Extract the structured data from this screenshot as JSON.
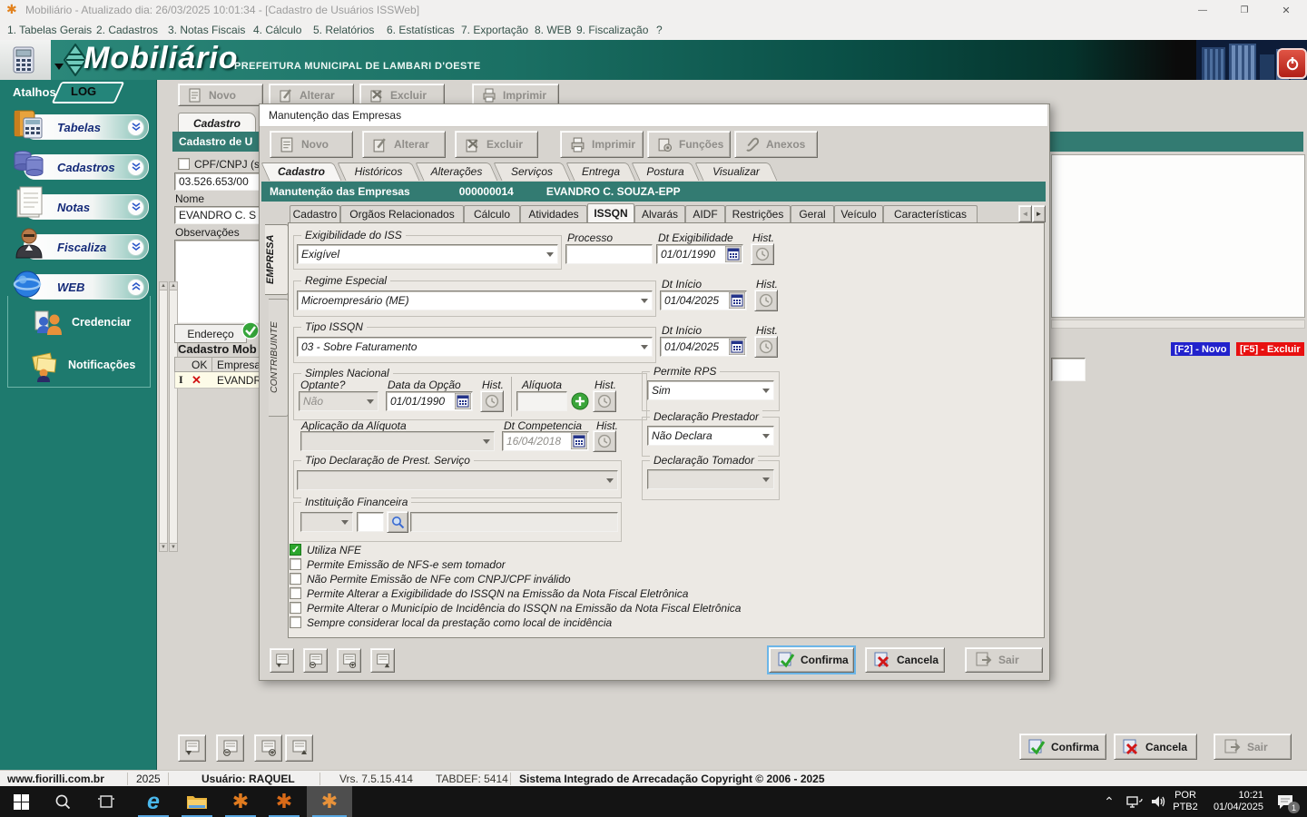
{
  "icons": {
    "app_flower": "✱",
    "minimize": "—",
    "maximize": "❐",
    "close": "✕",
    "check": "✓",
    "red_x": "✕",
    "text_cursor": "I",
    "chevron_up": "⌃",
    "arrow_left": "◄",
    "arrow_right": "►"
  },
  "window": {
    "title": "Mobiliário - Atualizado dia: 26/03/2025 10:01:34 - [Cadastro de Usuários ISSWeb]"
  },
  "menu": {
    "items": [
      "1. Tabelas Gerais",
      "2. Cadastros",
      "3. Notas Fiscais",
      "4. Cálculo",
      "5. Relatórios",
      "6. Estatísticas",
      "7. Exportação",
      "8. WEB",
      "9. Fiscalização",
      "?"
    ]
  },
  "header": {
    "logo": "Mobiliário",
    "subtitle": "PREFEITURA MUNICIPAL DE LAMBARI D'OESTE"
  },
  "sidebar": {
    "atalhos": "Atalhos",
    "log": "LOG",
    "items": [
      {
        "label": "Tabelas"
      },
      {
        "label": "Cadastros"
      },
      {
        "label": "Notas"
      },
      {
        "label": "Fiscaliza"
      },
      {
        "label": "WEB"
      }
    ],
    "web_children": [
      {
        "label": "Credenciar"
      },
      {
        "label": "Notificações"
      }
    ]
  },
  "main": {
    "toolbar": {
      "novo": "Novo",
      "alterar": "Alterar",
      "excluir": "Excluir",
      "imprimir": "Imprimir"
    },
    "tab_cadastro": "Cadastro",
    "header_title": "Cadastro de U",
    "form": {
      "cpf_label": "CPF/CNPJ (s",
      "cpf_value": "03.526.653/00",
      "nome_label": "Nome",
      "nome_value": "EVANDRO C. S",
      "obs_label": "Observações"
    },
    "endereco_tab": "Endereço",
    "cadastro_mob_title": "Cadastro Mob",
    "grid": {
      "col_ok": "OK",
      "col_empresa": "Empresa",
      "row_empresa": "EVANDR"
    },
    "badges": {
      "novo": "[F2] - Novo",
      "excluir": "[F5] - Excluir"
    },
    "footer": {
      "confirma": "Confirma",
      "cancela": "Cancela",
      "sair": "Sair"
    }
  },
  "dialog": {
    "title": "Manutenção das Empresas",
    "toolbar": {
      "novo": "Novo",
      "alterar": "Alterar",
      "excluir": "Excluir",
      "imprimir": "Imprimir",
      "funcoes": "Funções",
      "anexos": "Anexos"
    },
    "tabs": [
      {
        "label": "Cadastro"
      },
      {
        "label": "Históricos"
      },
      {
        "label": "Alterações"
      },
      {
        "label": "Serviços"
      },
      {
        "label": "Entrega"
      },
      {
        "label": "Postura"
      },
      {
        "label": "Visualizar"
      }
    ],
    "record": {
      "title": "Manutenção das Empresas",
      "code": "000000014",
      "name": "EVANDRO C. SOUZA-EPP"
    },
    "inner_tabs": [
      {
        "label": "Cadastro"
      },
      {
        "label": "Orgãos Relacionados"
      },
      {
        "label": "Cálculo"
      },
      {
        "label": "Atividades"
      },
      {
        "label": "ISSQN"
      },
      {
        "label": "Alvarás"
      },
      {
        "label": "AIDF"
      },
      {
        "label": "Restrições"
      },
      {
        "label": "Geral"
      },
      {
        "label": "Veículo"
      },
      {
        "label": "Características"
      }
    ],
    "side_tabs": {
      "empresa": "EMPRESA",
      "contribuinte": "CONTRIBUINTE"
    },
    "form": {
      "hist_label": "Hist.",
      "exigibilidade_group": "Exigibilidade do ISS",
      "exigibilidade_value": "Exigível",
      "processo_label": "Processo",
      "processo_value": "",
      "dt_exigibilidade_label": "Dt Exigibilidade",
      "dt_exigibilidade_value": "01/01/1990",
      "regime_group": "Regime Especial",
      "regime_value": "Microempresário (ME)",
      "dt_inicio_label": "Dt Início",
      "regime_dt_value": "01/04/2025",
      "tipo_group": "Tipo ISSQN",
      "tipo_value": "03 - Sobre Faturamento",
      "tipo_dt_value": "01/04/2025",
      "simples_group": "Simples Nacional",
      "optante_label": "Optante?",
      "optante_value": "Não",
      "data_opcao_label": "Data da Opção",
      "data_opcao_value": "01/01/1990",
      "aliquota_label": "Alíquota",
      "aliquota_value": "",
      "aplicacao_label": "Aplicação da Alíquota",
      "dt_competencia_label": "Dt Competencia",
      "dt_competencia_value": "16/04/2018",
      "permite_rps_label": "Permite RPS",
      "permite_rps_value": "Sim",
      "declaracao_prestador_label": "Declaração Prestador",
      "declaracao_prestador_value": "Não Declara",
      "declaracao_tomador_label": "Declaração Tomador",
      "declaracao_tomador_value": "",
      "tipo_declaracao_label": "Tipo Declaração de Prest. Serviço",
      "instituicao_label": "Instituição Financeira",
      "checkboxes": [
        {
          "label": "Utiliza NFE",
          "checked": true
        },
        {
          "label": "Permite Emissão de NFS-e sem tomador",
          "checked": false
        },
        {
          "label": "Não Permite Emissão de NFe com CNPJ/CPF inválido",
          "checked": false
        },
        {
          "label": "Permite Alterar a Exigibilidade do ISSQN na Emissão da Nota Fiscal Eletrônica",
          "checked": false
        },
        {
          "label": "Permite Alterar o Município de Incidência do ISSQN na Emissão da Nota Fiscal Eletrônica",
          "checked": false
        },
        {
          "label": "Sempre considerar local da prestação como local de incidência",
          "checked": false
        }
      ]
    },
    "footer": {
      "confirma": "Confirma",
      "cancela": "Cancela",
      "sair": "Sair"
    }
  },
  "statusbar": {
    "site": "www.fiorilli.com.br",
    "year": "2025",
    "user": "Usuário: RAQUEL",
    "version": "Vrs. 7.5.15.414",
    "tabdef": "TABDEF: 5414",
    "copyright": "Sistema Integrado de Arrecadação Copyright © 2006 - 2025"
  },
  "taskbar": {
    "lang_top": "POR",
    "lang_bottom": "PTB2",
    "time": "10:21",
    "date": "01/04/2025",
    "notification_count": "1"
  }
}
